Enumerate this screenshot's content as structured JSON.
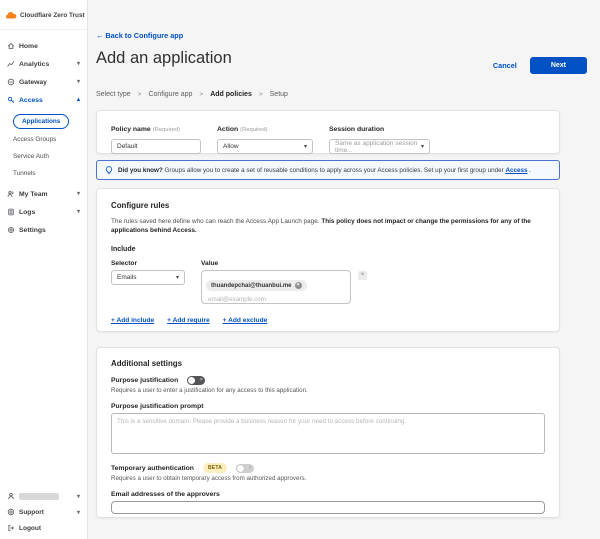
{
  "app": {
    "logo_label": "Cloudflare Zero Trust"
  },
  "glyphs": {
    "back_arrow": "←",
    "chevron_down": "▾",
    "chevron_up": "▴",
    "dropdown_caret": "▾",
    "close": "×"
  },
  "colors": {
    "brand_blue": "#0051c3",
    "cloudflare_orange": "#f6821f",
    "banner_border": "#4a72d4",
    "banner_bg": "#f4f8ff",
    "beta_bg": "#fceebe",
    "beta_text": "#7a5c00"
  },
  "sidebar": {
    "items": [
      {
        "label": "Home"
      },
      {
        "label": "Analytics"
      },
      {
        "label": "Gateway"
      },
      {
        "label": "Access"
      },
      {
        "label": "My Team"
      },
      {
        "label": "Logs"
      },
      {
        "label": "Settings"
      }
    ],
    "access_subitems": {
      "applications": "Applications",
      "access_groups": "Access Groups",
      "service_auth": "Service Auth",
      "tunnels": "Tunnels"
    },
    "footer": {
      "support": "Support",
      "logout": "Logout"
    }
  },
  "header": {
    "back_link": "Back to Configure app",
    "title": "Add an application",
    "cancel_label": "Cancel",
    "next_label": "Next"
  },
  "steps": {
    "items": [
      "Select type",
      "Configure app",
      "Add policies",
      "Setup"
    ],
    "active": "Add policies",
    "separator": ">"
  },
  "policy_card": {
    "policy_name_label": "Policy name",
    "required_hint": "(Required)",
    "policy_name_value": "Default",
    "action_label": "Action",
    "action_value": "Allow",
    "session_label": "Session duration",
    "session_value": "Same as application session time..."
  },
  "banner": {
    "lead": "Did you know?",
    "text": " Groups allow you to create a set of reusable conditions to apply across your Access policies. Set up your first group under ",
    "link": "Access",
    "suffix": " ."
  },
  "rules_card": {
    "title": "Configure rules",
    "desc": "The rules saved here define who can reach the Access App Launch page. ",
    "desc_bold": "This policy does not impact or change the permissions for any of the applications behind Access.",
    "include_label": "Include",
    "selector_label": "Selector",
    "selector_value": "Emails",
    "value_label": "Value",
    "email_tag": "thuandepchai@thuanbui.me",
    "value_placeholder": "email@example.com",
    "add_include": "+ Add include",
    "add_require": "+ Add require",
    "add_exclude": "+ Add exclude"
  },
  "settings_card": {
    "title": "Additional settings",
    "purpose_label": "Purpose justification",
    "purpose_desc": "Requires a user to enter a justification for any access to this application.",
    "prompt_label": "Purpose justification prompt",
    "prompt_placeholder": "This is a sensitive domain. Please provide a business reason for your need to access before continuing.",
    "temp_label": "Temporary authentication",
    "beta_label": "BETA",
    "temp_desc": "Requires a user to obtain temporary access from authorized approvers.",
    "approvers_label": "Email addresses of the approvers"
  }
}
